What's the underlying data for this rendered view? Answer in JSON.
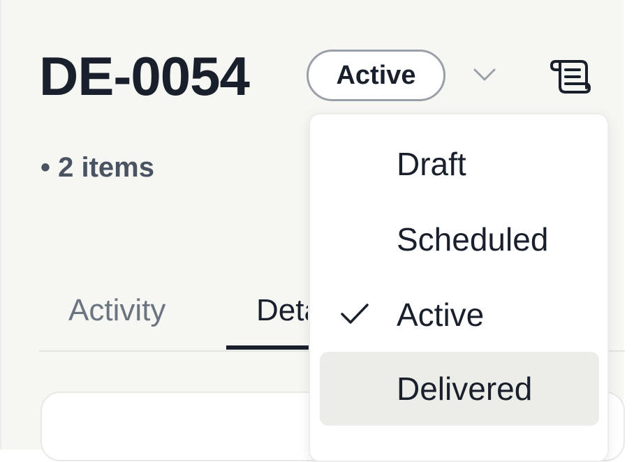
{
  "header": {
    "title": "DE-0054",
    "status_label": "Active",
    "items_meta": "• 2 items"
  },
  "tabs": [
    {
      "label": "Activity"
    },
    {
      "label": "Details"
    }
  ],
  "status_menu": {
    "options": [
      {
        "label": "Draft",
        "selected": false
      },
      {
        "label": "Scheduled",
        "selected": false
      },
      {
        "label": "Active",
        "selected": true
      },
      {
        "label": "Delivered",
        "selected": false,
        "hovered": true
      }
    ]
  },
  "icons": {
    "chevron": "chevron-down-icon",
    "document": "scroll-document-icon",
    "check": "check-icon"
  },
  "colors": {
    "text_primary": "#19202c",
    "text_muted": "#6b7480",
    "page_bg": "#f6f6f3",
    "hover_bg": "#ecede9"
  }
}
